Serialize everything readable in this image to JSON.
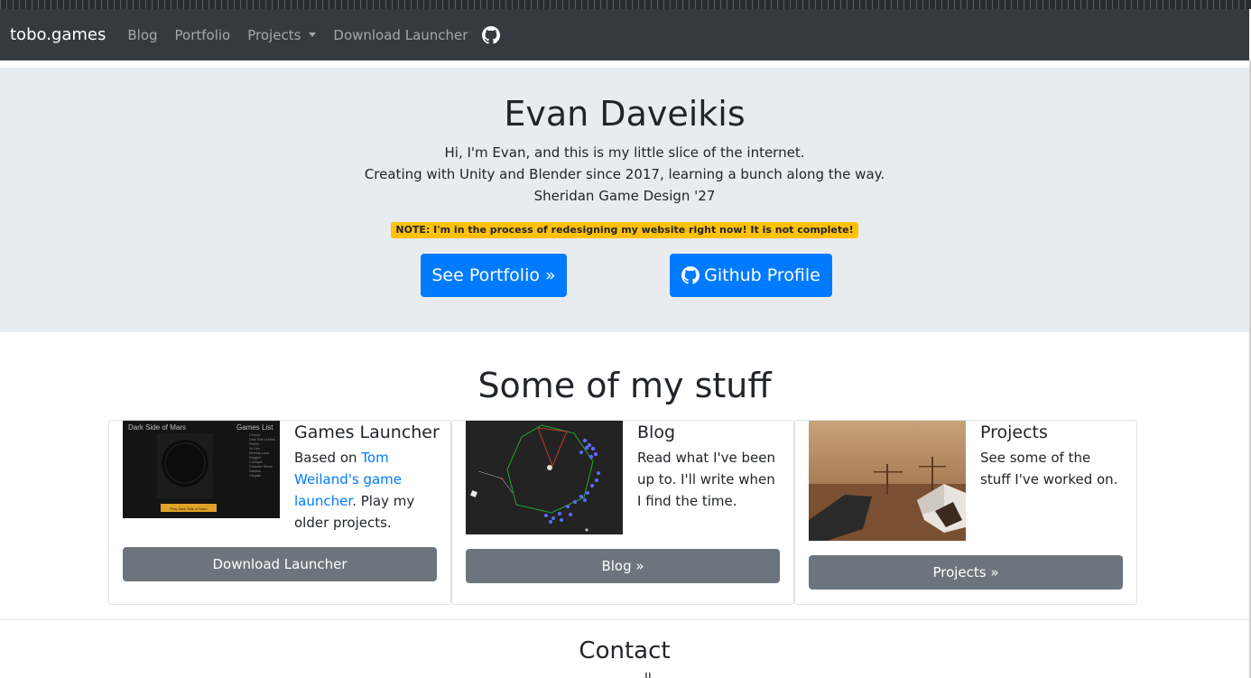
{
  "navbar": {
    "brand": "tobo.games",
    "links": [
      "Blog",
      "Portfolio",
      "Projects",
      "Download Launcher"
    ],
    "icon": "github-icon"
  },
  "hero": {
    "title": "Evan Daveikis",
    "lines": [
      "Hi, I'm Evan, and this is my little slice of the internet.",
      "Creating with Unity and Blender since 2017, learning a bunch along the way.",
      "Sheridan Game Design '27"
    ],
    "note": "NOTE: I'm in the process of redesigning my website right now! It is not complete!",
    "portfolio_button": "See Portfolio »",
    "github_button": "Github Profile"
  },
  "stuff": {
    "title": "Some of my stuff",
    "cards": [
      {
        "title": "Games Launcher",
        "text_before": "Based on ",
        "link_text": "Tom Weiland's game launcher",
        "text_after": ". Play my older projects.",
        "button": "Download Launcher",
        "thumb": {
          "heading_left": "Dark Side of Mars",
          "heading_right": "Games List",
          "list": [
            "C'tenne",
            "Dark Side of Mars",
            "Firefire",
            "Sir Dev",
            "Memory Lane",
            "Rogged",
            "C-Unique",
            "Chamber Sense",
            "Gasless",
            "Cargate"
          ],
          "play_label": "Play Dark Side of Mars"
        }
      },
      {
        "title": "Blog",
        "text": "Read what I've been up to. I'll write when I find the time.",
        "button": "Blog »"
      },
      {
        "title": "Projects",
        "text": "See some of the stuff I've worked on.",
        "button": "Projects »"
      }
    ]
  },
  "contact": {
    "title": "Contact",
    "partial": "ll"
  },
  "colors": {
    "navbar": "#343a40",
    "jumbotron": "#e9ecef",
    "primary": "#007bff",
    "secondary": "#6c757d",
    "warning": "#ffc107"
  }
}
